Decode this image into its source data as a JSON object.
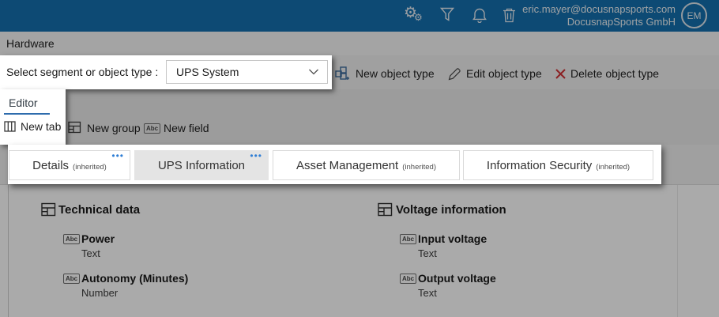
{
  "colors": {
    "topbar": "#146fae",
    "accent_blue": "#2e7ed5",
    "editor_underline": "#2e6cad",
    "delete_red": "#d13438",
    "active_tab_bg": "#e4e4e4"
  },
  "topbar": {
    "icons": [
      "settings-gears-icon",
      "filter-icon",
      "notifications-bell-icon",
      "trash-icon"
    ],
    "email": "eric.mayer@docusnapsports.com",
    "org": "DocusnapSports GmbH",
    "avatar_initials": "EM"
  },
  "page": {
    "breadcrumb": "Hardware"
  },
  "segment": {
    "label": "Select segment or object type :",
    "value": "UPS System",
    "actions": [
      "New object type",
      "Edit object type",
      "Delete object type"
    ]
  },
  "editor": {
    "tab": "Editor",
    "toolbar": [
      "New tab",
      "New group",
      "New field"
    ]
  },
  "tabs": [
    {
      "label": "Details",
      "suffix": "(inherited)",
      "active": false,
      "has_menu": true
    },
    {
      "label": "UPS Information",
      "suffix": "",
      "active": true,
      "has_menu": true
    },
    {
      "label": "Asset Management",
      "suffix": "(inherited)",
      "active": false,
      "has_menu": false
    },
    {
      "label": "Information Security",
      "suffix": "(inherited)",
      "active": false,
      "has_menu": false
    }
  ],
  "content": {
    "groups": [
      {
        "title": "Technical data",
        "fields": [
          {
            "name": "Power",
            "type": "Text"
          },
          {
            "name": "Autonomy (Minutes)",
            "type": "Number"
          }
        ]
      },
      {
        "title": "Voltage information",
        "fields": [
          {
            "name": "Input voltage",
            "type": "Text"
          },
          {
            "name": "Output voltage",
            "type": "Text"
          }
        ]
      }
    ]
  },
  "icons": {
    "gear": "⚙",
    "abc_label": "Abc",
    "more_dots": "•••"
  }
}
